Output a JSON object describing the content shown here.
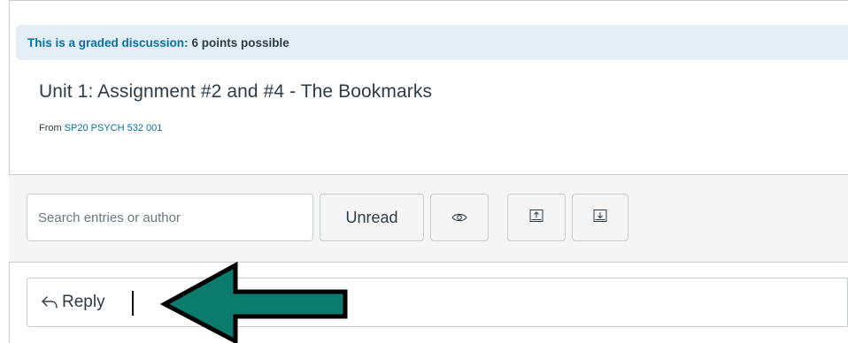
{
  "banner": {
    "graded_label": "This is a graded discussion:",
    "points": "6 points possible"
  },
  "discussion": {
    "title": "Unit 1: Assignment #2 and #4 - The Bookmarks",
    "from_label": "From",
    "course_link": "SP20 PSYCH 532 001"
  },
  "toolbar": {
    "search_placeholder": "Search entries or author",
    "unread_label": "Unread",
    "icons": [
      "eye-icon",
      "expand-up-icon",
      "collapse-down-icon"
    ]
  },
  "reply": {
    "label": "Reply"
  },
  "colors": {
    "banner_bg": "#e3eef7",
    "link": "#0770a3",
    "arrow_fill": "#0b7b6d"
  }
}
